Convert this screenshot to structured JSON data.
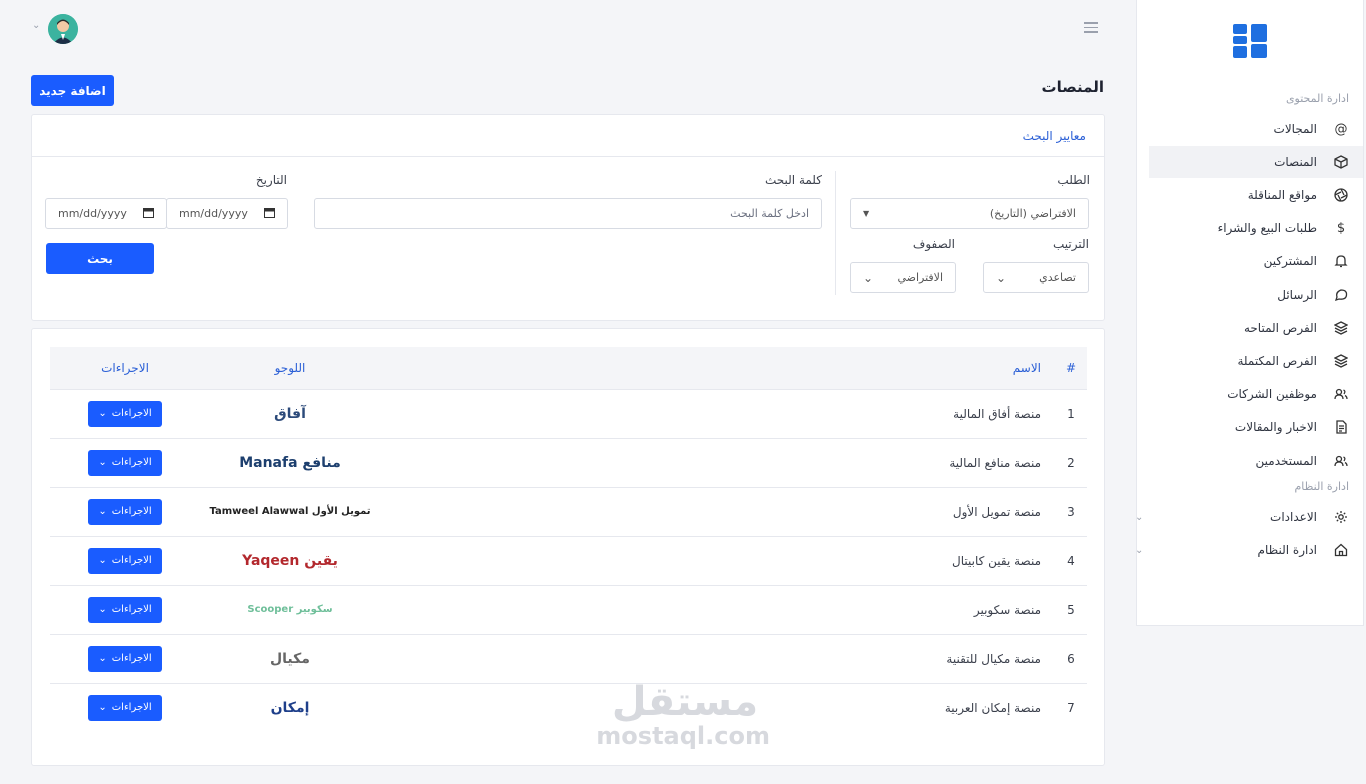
{
  "header": {
    "menu_icon": "hamburger-icon",
    "user_menu_icon": "chevron-down-icon"
  },
  "page": {
    "title": "المنصات",
    "add_button": "اضافة جديد"
  },
  "sidebar": {
    "section_content": "ادارة المحتوى",
    "section_system": "ادارة النظام",
    "items": [
      {
        "label": "المجالات",
        "icon": "at-icon"
      },
      {
        "label": "المنصات",
        "icon": "cube-icon",
        "active": true
      },
      {
        "label": "مواقع المناقلة",
        "icon": "aperture-icon"
      },
      {
        "label": "طلبات البيع والشراء",
        "icon": "dollar-icon"
      },
      {
        "label": "المشتركين",
        "icon": "bell-icon"
      },
      {
        "label": "الرسائل",
        "icon": "chat-icon"
      },
      {
        "label": "الفرص المتاحه",
        "icon": "layers-icon"
      },
      {
        "label": "الفرص المكتملة",
        "icon": "layers-icon"
      },
      {
        "label": "موظفين الشركات",
        "icon": "users-icon"
      },
      {
        "label": "الاخبار والمقالات",
        "icon": "document-icon"
      },
      {
        "label": "المستخدمين",
        "icon": "users-icon"
      }
    ],
    "system_items": [
      {
        "label": "الاعدادات",
        "icon": "gear-icon"
      },
      {
        "label": "ادارة النظام",
        "icon": "home-icon"
      }
    ]
  },
  "filters": {
    "title": "معايير البحث",
    "order_label": "الطلب",
    "order_value": "الافتراضي (التاريخ)",
    "sort_label": "الترتيب",
    "sort_value": "تصاعدي",
    "rows_label": "الصفوف",
    "rows_value": "الافتراضي",
    "keyword_label": "كلمة البحث",
    "keyword_placeholder": "ادخل كلمة البحث",
    "date_label": "التاريخ",
    "date_from": "mm/dd/yyyy",
    "date_to": "mm/dd/yyyy",
    "search_button": "بحث"
  },
  "table": {
    "headers": {
      "num": "#",
      "name": "الاسم",
      "logo": "اللوجو",
      "actions": "الاجراءات"
    },
    "action_label": "الاجراءات",
    "rows": [
      {
        "num": "1",
        "name": "منصة أفاق المالية",
        "logo": "آفاق",
        "logo_color": "#2c4a7a"
      },
      {
        "num": "2",
        "name": "منصة منافع المالية",
        "logo": "منافع Manafa",
        "logo_color": "#1d3f6e"
      },
      {
        "num": "3",
        "name": "منصة تمويل الأول",
        "logo": "تمويل الأول Tamweel Alawwal",
        "logo_color": "#222"
      },
      {
        "num": "4",
        "name": "منصة يقين كابيتال",
        "logo": "يقين Yaqeen",
        "logo_color": "#b3282d"
      },
      {
        "num": "5",
        "name": "منصة سكوبير",
        "logo": "سكوبير Scooper",
        "logo_color": "#6fbf9a"
      },
      {
        "num": "6",
        "name": "منصة مكيال للتقنية",
        "logo": "مكيال",
        "logo_color": "#666"
      },
      {
        "num": "7",
        "name": "منصة إمكان العربية",
        "logo": "إمكان",
        "logo_color": "#1e3f8a"
      }
    ]
  },
  "watermark": {
    "ar": "مستقل",
    "en": "mostaql.com"
  },
  "colors": {
    "primary": "#1a5cff",
    "link": "#2a5fd6",
    "background": "#f4f5f8"
  }
}
